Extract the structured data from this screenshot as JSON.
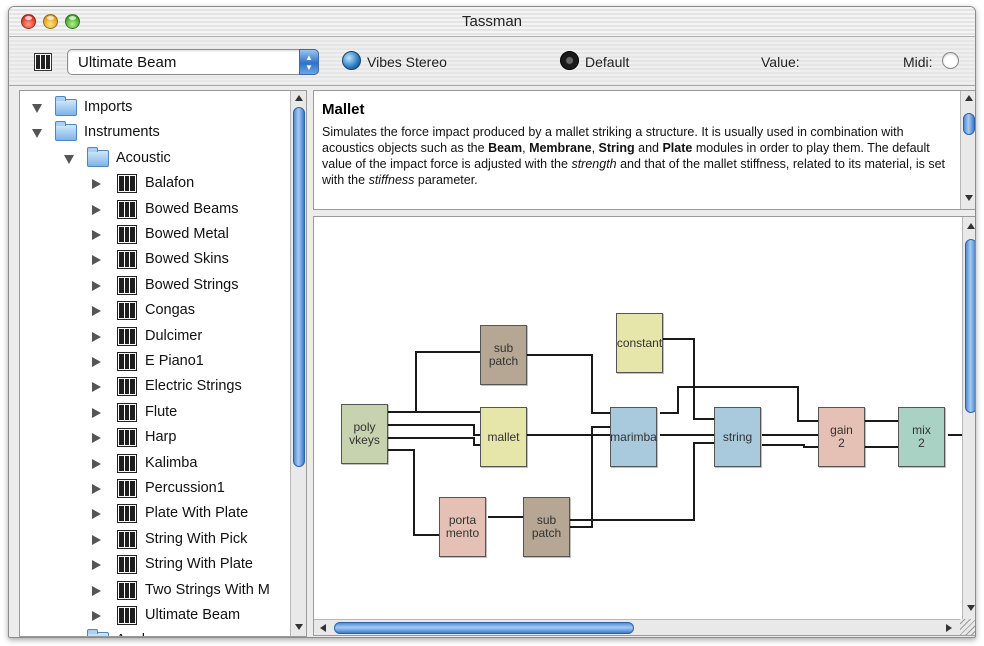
{
  "window": {
    "title": "Tassman"
  },
  "toolbar": {
    "instrument_popup": "Ultimate Beam",
    "preset_bank": "Vibes Stereo",
    "preset": "Default",
    "value_label": "Value:",
    "midi_label": "Midi:"
  },
  "icons": {
    "close": "close-button-red",
    "minimize": "minimize-button-yellow",
    "zoom": "zoom-button-green",
    "keyboard": "piano-keyboard-icon",
    "globe": "globe-icon",
    "dial": "knob-icon",
    "folder": "folder-icon",
    "instrument": "piano-keyboard-icon"
  },
  "sidebar": {
    "top_folders": [
      {
        "label": "Imports",
        "expanded": true
      },
      {
        "label": "Instruments",
        "expanded": true
      }
    ],
    "subfolder": {
      "label": "Acoustic",
      "expanded": true
    },
    "instruments": [
      "Balafon",
      "Bowed Beams",
      "Bowed Metal",
      "Bowed Skins",
      "Bowed Strings",
      "Congas",
      "Dulcimer",
      "E Piano1",
      "Electric Strings",
      "Flute",
      "Harp",
      "Kalimba",
      "Percussion1",
      "Plate With Plate",
      "String With Pick",
      "String With Plate",
      "Two Strings With M",
      "Ultimate Beam"
    ],
    "next_folder": {
      "label": "Analog",
      "expanded": false
    }
  },
  "description": {
    "title": "Mallet",
    "parts": [
      {
        "t": "Simulates the force impact produced by a mallet striking a structure. It is usually used in combination with acoustics objects such as the ",
        "s": ""
      },
      {
        "t": "Beam",
        "s": "b"
      },
      {
        "t": ", ",
        "s": ""
      },
      {
        "t": "Membrane",
        "s": "b"
      },
      {
        "t": ", ",
        "s": ""
      },
      {
        "t": "String",
        "s": "b"
      },
      {
        "t": " and ",
        "s": ""
      },
      {
        "t": "Plate",
        "s": "b"
      },
      {
        "t": " modules in order to play them. The default value of the impact force is adjusted with the ",
        "s": ""
      },
      {
        "t": "strength",
        "s": "i"
      },
      {
        "t": " and that of the mallet stiffness, related to its material, is set with the ",
        "s": ""
      },
      {
        "t": "stiffness",
        "s": "i"
      },
      {
        "t": " parameter.",
        "s": ""
      }
    ]
  },
  "patch": {
    "modules": [
      {
        "id": "polyvkeys",
        "label": "poly\nvkeys",
        "color": "#c6d3ae"
      },
      {
        "id": "subpatch1",
        "label": "sub\npatch",
        "color": "#b5a793"
      },
      {
        "id": "mallet",
        "label": "mallet",
        "color": "#e7e6aa"
      },
      {
        "id": "portamento",
        "label": "porta\nmento",
        "color": "#e4c1b4"
      },
      {
        "id": "subpatch2",
        "label": "sub\npatch",
        "color": "#b5a793"
      },
      {
        "id": "constant",
        "label": "constant",
        "color": "#e7e6aa"
      },
      {
        "id": "marimba",
        "label": "marimba",
        "color": "#a9cadc"
      },
      {
        "id": "string",
        "label": "string",
        "color": "#a9cadc"
      },
      {
        "id": "gain2",
        "label": "gain\n2",
        "color": "#e4c1b4"
      },
      {
        "id": "mix2",
        "label": "mix\n2",
        "color": "#a9d2c4"
      }
    ]
  }
}
